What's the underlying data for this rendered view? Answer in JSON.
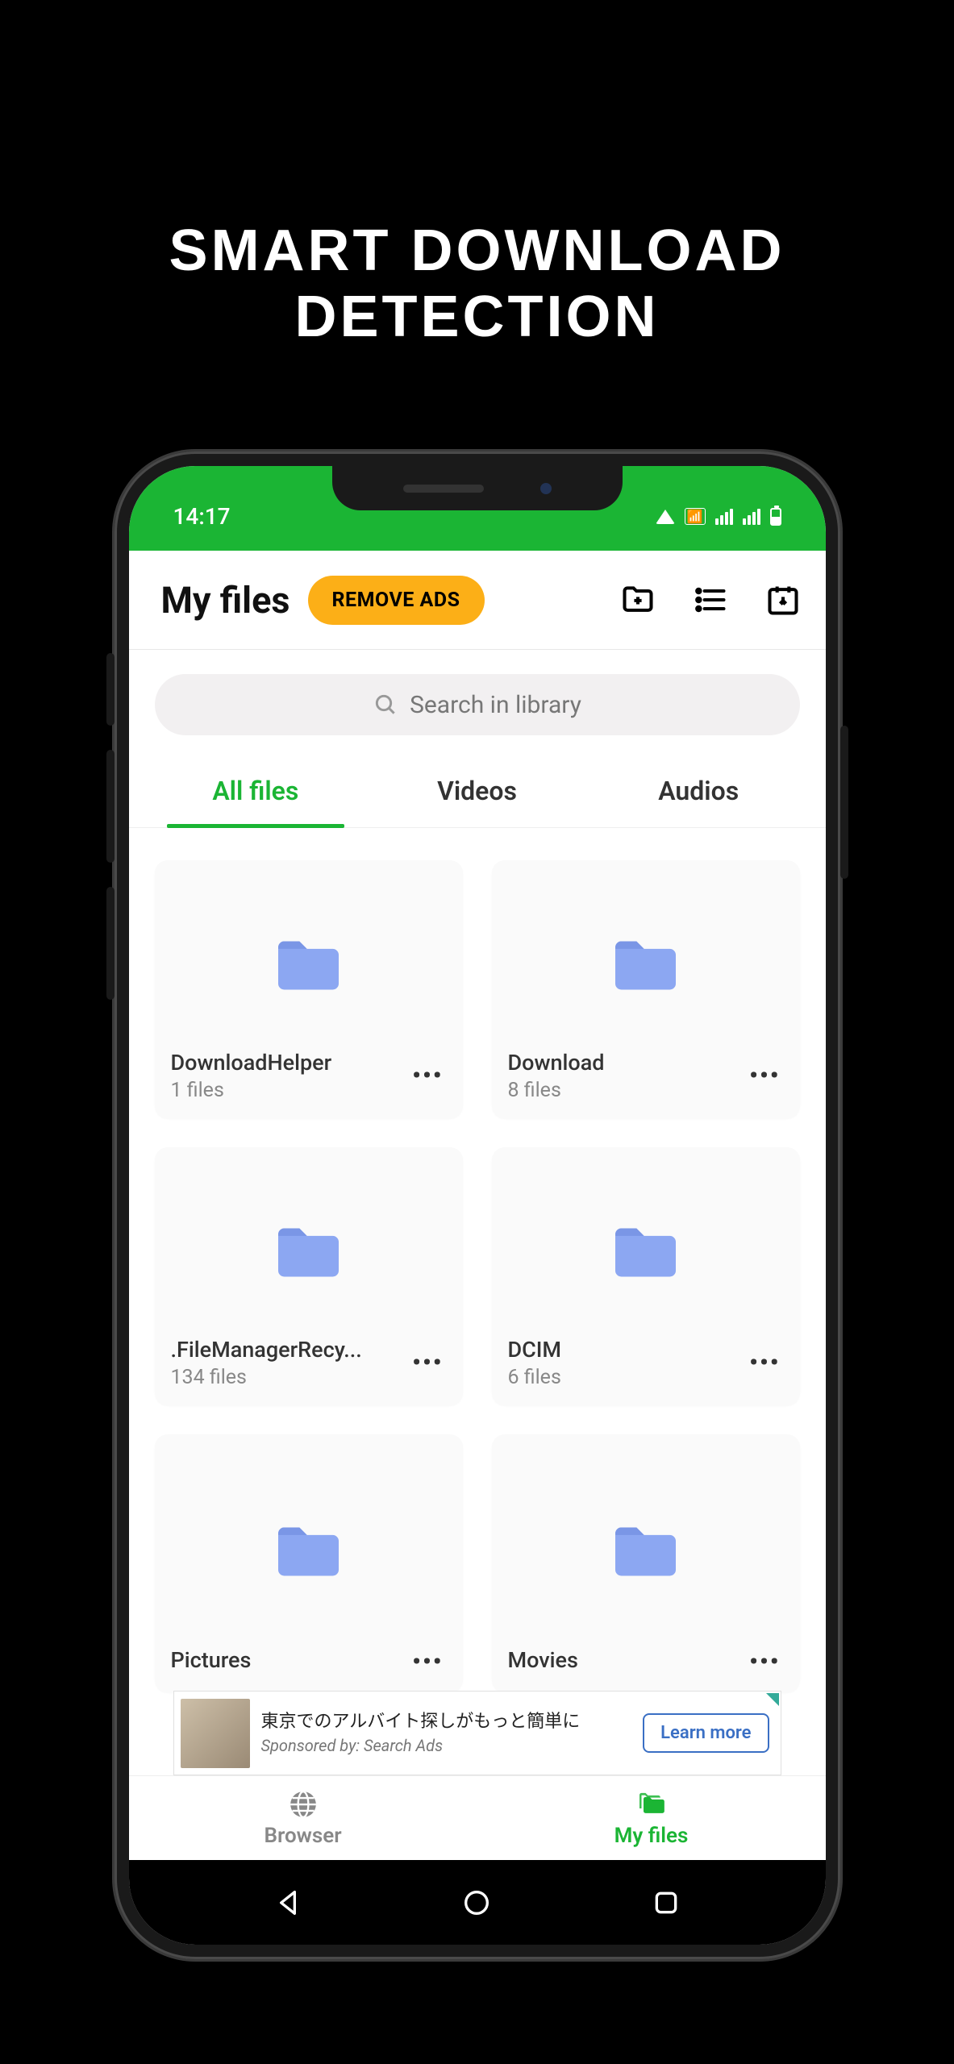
{
  "promo_headline": "SMART DOWNLOAD DETECTION",
  "status_bar": {
    "time": "14:17"
  },
  "header": {
    "title": "My files",
    "remove_ads_label": "REMOVE ADS"
  },
  "search": {
    "placeholder": "Search in library"
  },
  "tabs": {
    "all_files": "All files",
    "videos": "Videos",
    "audios": "Audios"
  },
  "folders": [
    {
      "name": "DownloadHelper",
      "count": "1 files"
    },
    {
      "name": "Download",
      "count": "8 files"
    },
    {
      "name": ".FileManagerRecy...",
      "count": "134 files"
    },
    {
      "name": "DCIM",
      "count": "6 files"
    },
    {
      "name": "Pictures",
      "count": ""
    },
    {
      "name": "Movies",
      "count": ""
    }
  ],
  "ad": {
    "text": "東京でのアルバイト探しがもっと簡単に",
    "sponsor": "Sponsored by: Search Ads",
    "button": "Learn more"
  },
  "bottom_nav": {
    "browser": "Browser",
    "my_files": "My files"
  },
  "colors": {
    "accent": "#1BB534",
    "ads_btn": "#FCAF17",
    "folder": "#8CA7F2"
  }
}
